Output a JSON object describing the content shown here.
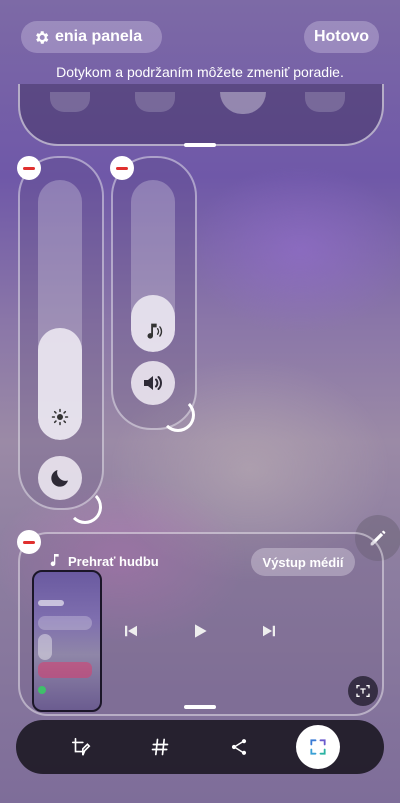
{
  "header": {
    "settings_label": "enia panela",
    "done_label": "Hotovo",
    "hint": "Dotykom a podržaním môžete zmeniť poradie."
  },
  "media": {
    "title": "Prehrať hudbu",
    "output_label": "Výstup médií"
  },
  "sliders": {
    "brightness_level": 0.43,
    "volume_level": 0.33
  },
  "toolbar": {
    "items": [
      "edit-tiles",
      "hashtag",
      "share",
      "capture"
    ]
  }
}
